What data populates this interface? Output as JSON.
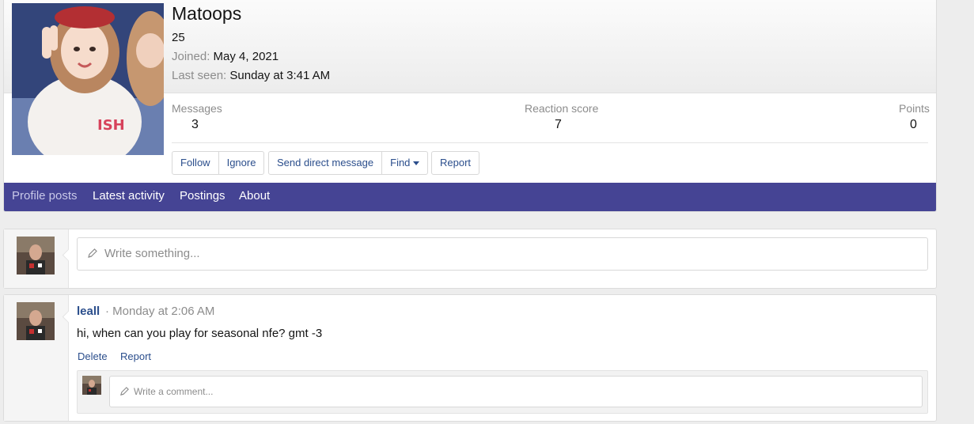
{
  "profile": {
    "username": "Matoops",
    "level": "25",
    "joined_label": "Joined:",
    "joined_value": "May 4, 2021",
    "last_seen_label": "Last seen:",
    "last_seen_value": "Sunday at 3:41 AM",
    "stats": [
      {
        "label": "Messages",
        "value": "3"
      },
      {
        "label": "Reaction score",
        "value": "7"
      },
      {
        "label": "Points",
        "value": "0"
      }
    ],
    "buttons": {
      "follow": "Follow",
      "ignore": "Ignore",
      "send_direct_message": "Send direct message",
      "find": "Find",
      "report": "Report"
    }
  },
  "tabs": [
    {
      "label": "Profile posts",
      "active": true
    },
    {
      "label": "Latest activity",
      "active": false
    },
    {
      "label": "Postings",
      "active": false
    },
    {
      "label": "About",
      "active": false
    }
  ],
  "composer": {
    "placeholder": "Write something..."
  },
  "post": {
    "author": "leall",
    "meta": "· Monday at 2:06 AM",
    "body": "hi, when can you play for seasonal nfe? gmt -3",
    "actions": {
      "delete": "Delete",
      "report": "Report"
    },
    "comment_placeholder": "Write a comment..."
  },
  "colors": {
    "tab_bar": "#454494",
    "link": "#2b4e8c",
    "muted_text": "#8c8c8c"
  },
  "icons": {
    "pencil": "pencil-icon",
    "dropdown": "caret-down-icon"
  }
}
